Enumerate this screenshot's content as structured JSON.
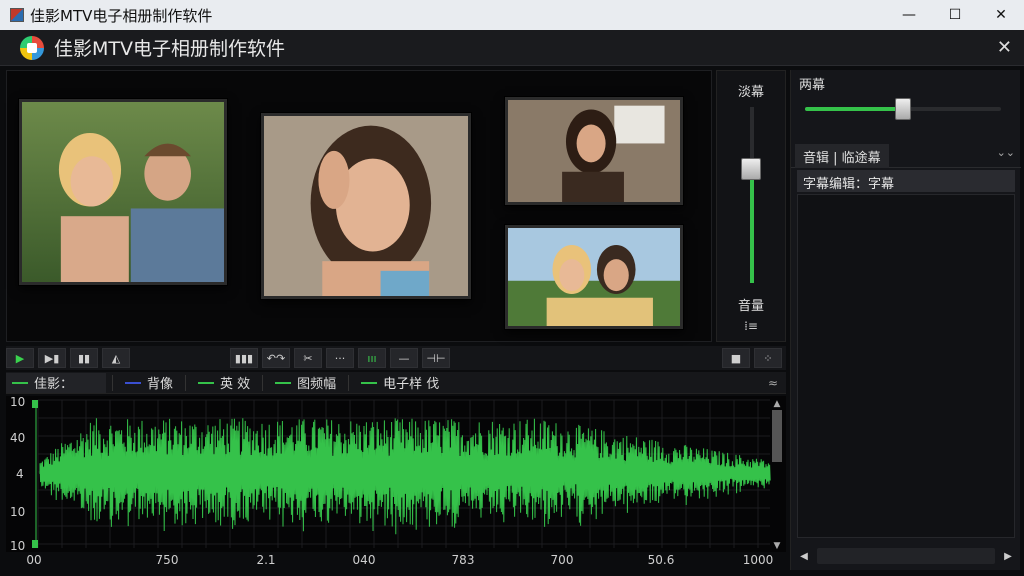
{
  "window": {
    "os_title": "佳影MTV电子相册制作软件",
    "controls": {
      "minimize": "—",
      "maximize": "☐",
      "close": "✕"
    }
  },
  "app": {
    "title": "佳影MTV电子相册制作软件",
    "close": "✕"
  },
  "preview": {
    "photos": [
      {
        "subject": "couple"
      },
      {
        "subject": "woman-portrait"
      },
      {
        "subject": "woman-indoor"
      },
      {
        "subject": "two-women"
      }
    ]
  },
  "vertical_slider": {
    "top_label": "淡幕",
    "bottom_label": "音量",
    "icon": "⁞≡",
    "level": 0.65,
    "fill_color": "#35c24a"
  },
  "right_panel": {
    "slider_label": "两幕",
    "slider_level": 0.5,
    "tab_label": "音辑 | 临途幕",
    "tab_extra": "⌄⌄",
    "list_header": "字幕编辑：字幕",
    "scroll_left": "◀",
    "scroll_right": "▶"
  },
  "transport": {
    "left_buttons": [
      {
        "icon": "play-icon",
        "glyph": "▶"
      },
      {
        "icon": "step-icon",
        "glyph": "▶▮"
      },
      {
        "icon": "stop-icon",
        "glyph": "▮▮"
      },
      {
        "icon": "mark-icon",
        "glyph": "◭"
      }
    ],
    "middle_buttons": [
      {
        "icon": "bars-icon",
        "glyph": "▮▮▮"
      },
      {
        "icon": "undo-icon",
        "glyph": "↶↷"
      },
      {
        "icon": "cut-icon",
        "glyph": "✂"
      },
      {
        "icon": "dots-icon",
        "glyph": "···"
      },
      {
        "icon": "level-icon",
        "glyph": "ııı"
      },
      {
        "icon": "line-icon",
        "glyph": "—"
      },
      {
        "icon": "split-icon",
        "glyph": "⊣⊢"
      }
    ],
    "right_buttons": [
      {
        "icon": "square-icon",
        "glyph": "■"
      },
      {
        "icon": "grid-icon",
        "glyph": "⁘"
      }
    ]
  },
  "tracks": [
    {
      "label": "佳影："
    },
    {
      "label": "背像"
    },
    {
      "label": "英  效"
    },
    {
      "label": "图频幅"
    },
    {
      "label": "电子样  伐"
    }
  ],
  "tracks_right": "≈",
  "waveform": {
    "color": "#35c24a",
    "y_labels": [
      "10",
      "40",
      "4",
      "10",
      "10"
    ],
    "x_labels": [
      "00",
      "750",
      "2.1",
      "040",
      "783",
      "700",
      "50.6",
      "1000"
    ]
  }
}
